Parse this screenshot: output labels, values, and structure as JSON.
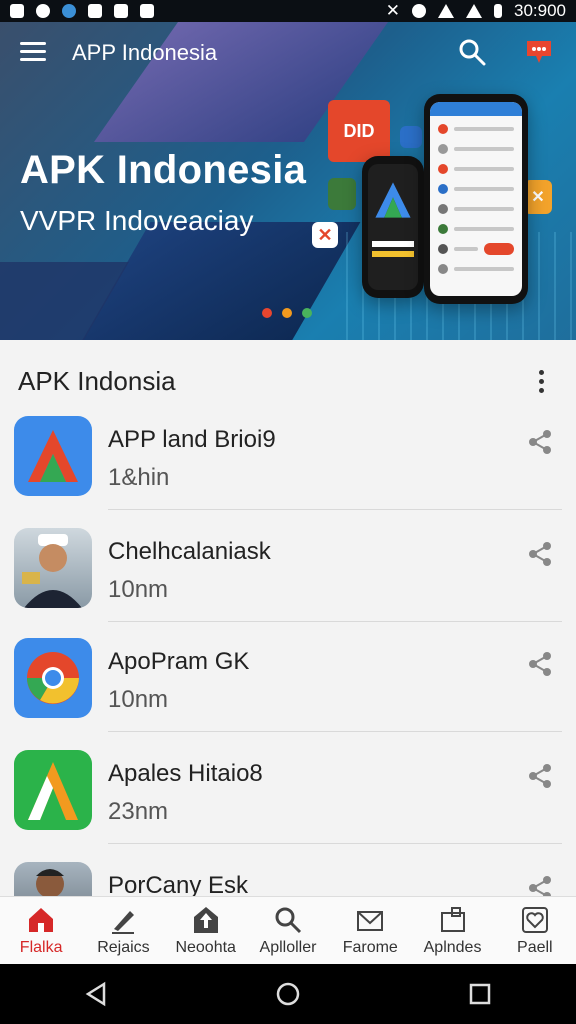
{
  "status_bar": {
    "time": "30:900"
  },
  "app_bar": {
    "title": "APP Indonesia"
  },
  "hero": {
    "title": "APK Indonesia",
    "subtitle": "VVPR Indoveaciay",
    "tile_label": "DID",
    "carousel_colors": [
      "#e8462f",
      "#f29a1f",
      "#49b35c"
    ]
  },
  "section": {
    "title": "APK Indonsia"
  },
  "apps": [
    {
      "name": "APP land Brioi9",
      "size": "1&hin",
      "icon": "android-studio-icon"
    },
    {
      "name": "Chelhcalaniask",
      "size": "10nm",
      "icon": "person-photo-icon"
    },
    {
      "name": "ApoPram GK",
      "size": "10nm",
      "icon": "chrome-icon"
    },
    {
      "name": "Apales Hitaio8",
      "size": "23nm",
      "icon": "letter-a-icon"
    },
    {
      "name": "PorCany Esk",
      "size": "",
      "icon": "person-photo-icon"
    }
  ],
  "bottom_nav": [
    {
      "label": "Flalka",
      "icon": "home-icon",
      "active": true
    },
    {
      "label": "Rejaics",
      "icon": "pen-icon",
      "active": false
    },
    {
      "label": "Neoohta",
      "icon": "upload-home-icon",
      "active": false
    },
    {
      "label": "Aplloller",
      "icon": "search-icon",
      "active": false
    },
    {
      "label": "Farome",
      "icon": "mail-icon",
      "active": false
    },
    {
      "label": "Aplndes",
      "icon": "apps-icon",
      "active": false
    },
    {
      "label": "Paell",
      "icon": "heart-icon",
      "active": false
    }
  ],
  "colors": {
    "accent": "#d62828",
    "hero_bg": "#1d5f8c"
  }
}
